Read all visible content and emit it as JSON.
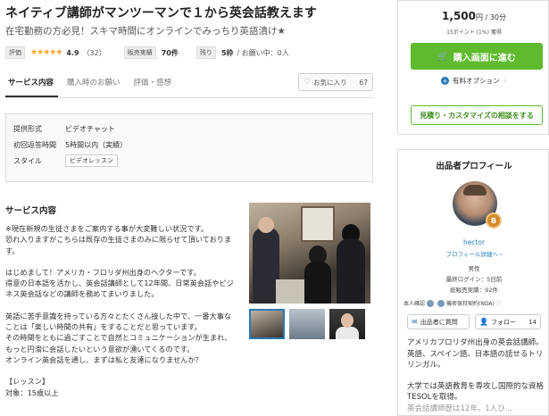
{
  "service": {
    "title": "ネイティブ講師がマンツーマンで１から英会話教えます",
    "subtitle": "在宅勤務の方必見！スキマ時間にオンラインでみっちり英語漬け★"
  },
  "meta": {
    "rating_tag": "評価",
    "stars": "★★★★★",
    "rating_value": "4.9",
    "review_count": "（32）",
    "sales_tag": "販売実績",
    "sales_value": "70件",
    "remain_tag": "残り",
    "remain_value": "5枠",
    "requests_label": "/ お願い中：",
    "requests_value": "0人"
  },
  "tabs": [
    {
      "label": "サービス内容"
    },
    {
      "label": "購入時のお願い"
    },
    {
      "label": "評価・感想"
    }
  ],
  "favorite": {
    "label": "お気に入り",
    "count": "67"
  },
  "specs": [
    {
      "key": "提供形式",
      "value": "ビデオチャット"
    },
    {
      "key": "初回返答時間",
      "value": "5時間以内（実績）"
    },
    {
      "key": "スタイル",
      "value": "ビデオレッスン"
    }
  ],
  "description": {
    "heading": "サービス内容",
    "lines": [
      "※現在新規の生徒さまをご案内する事が大変難しい状況です。",
      "恐れ入りますがこちらは既存の生徒さまのみに限らせて頂いておりま",
      "す。",
      "",
      "はじめまして！アメリカ・フロリダ州出身のヘクターです。",
      "得意の日本語を活かし、英会話講師として12年間、日常英会話やビジ",
      "ネス英会話などの講師を務めてまいりました。",
      "",
      "英語に苦手意識を持っている方々とたくさん接した中で、一番大事な",
      "ことは「楽しい時間の共有」をすることだと思っています。",
      "その時間をともに過ごすことで自然とコミュニケーションが生まれ、",
      "もっと円滑に会話したいという意欲が湧いてくるのです。",
      "オンライン英会話を通し、まずは私と友達になりませんか？",
      "",
      "【レッスン】",
      "対象：15歳以上"
    ]
  },
  "price": {
    "amount": "1,500",
    "unit": "円 / 30分",
    "points": "15ポイント (1%) 獲得",
    "buy_label": "購入画面に進む",
    "option_label": "有料オプション",
    "quote_label": "見積り・カスタマイズの相談をする"
  },
  "profile": {
    "heading": "出品者プロフィール",
    "badge": "B",
    "name": "hector",
    "detail_link": "プロフィール詳細へ ›",
    "gender": "男性",
    "last_login": "最終ログイン：5日前",
    "total_sales": "総販売実績：92件",
    "id_verified": "本人確認",
    "nda_label": "機密保持契約(NDA)",
    "message_label": "出品者に質問",
    "follow_label": "フォロー",
    "follow_count": "14",
    "bio": [
      "アメリカフロリダ州出身の英会話講師。",
      "英語、スペイン語、日本語の話せるトリリンガル。",
      "",
      "大学では英語教育を専攻し国際的な資格TESOLを取得。",
      "英会話講師歴は12年。1人ひ..."
    ]
  },
  "icons": {
    "heart": "heart-icon",
    "cart": "cart-icon",
    "plus": "plus-circle-icon",
    "envelope": "envelope-icon",
    "person": "person-icon"
  },
  "colors": {
    "primary_green": "#5fba2e",
    "link_blue": "#2a7ab8",
    "star": "#f5a623",
    "badge": "#d48a2a"
  }
}
